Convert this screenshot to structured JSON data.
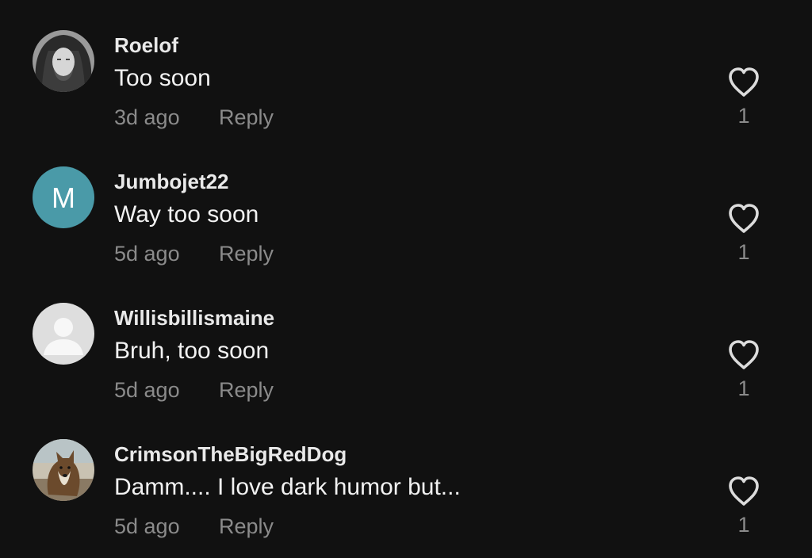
{
  "comments": [
    {
      "username": "Roelof",
      "text": "Too soon",
      "time": "3d ago",
      "reply_label": "Reply",
      "likes": "1"
    },
    {
      "username": "Jumbojet22",
      "text": "Way too soon",
      "time": "5d ago",
      "reply_label": "Reply",
      "likes": "1",
      "avatar_letter": "M",
      "avatar_color": "#4a9aa8"
    },
    {
      "username": "Willisbillismaine",
      "text": "Bruh, too soon",
      "time": "5d ago",
      "reply_label": "Reply",
      "likes": "1"
    },
    {
      "username": "CrimsonTheBigRedDog",
      "text": "Damm.... I love dark humor but...",
      "time": "5d ago",
      "reply_label": "Reply",
      "likes": "1"
    }
  ],
  "icons": {
    "like": "heart-outline-icon",
    "default_avatar": "user-silhouette-icon"
  },
  "colors": {
    "background": "#111111",
    "username": "#e9e9e9",
    "text": "#f2f2f2",
    "muted": "#8b8b8b"
  }
}
